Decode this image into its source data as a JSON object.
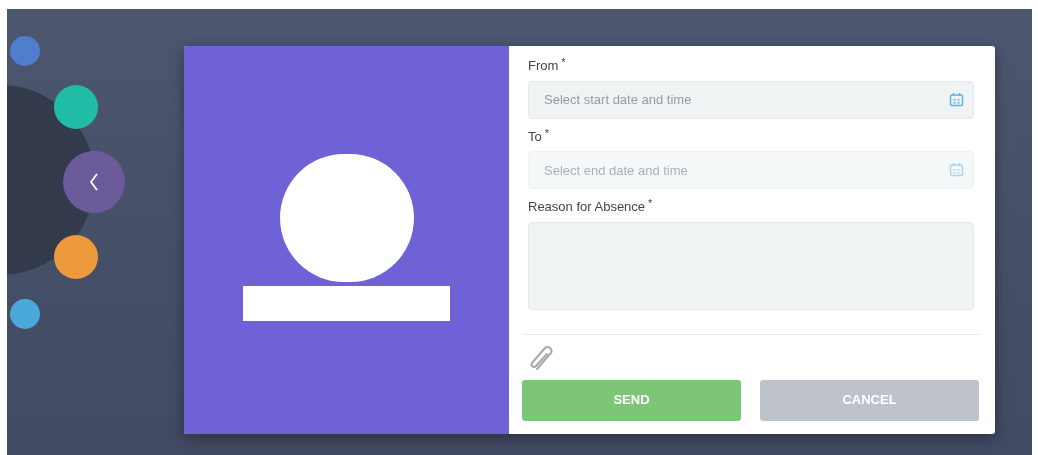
{
  "side_menu": {
    "dots": [
      {
        "color": "#4f7fcc"
      },
      {
        "color": "#1fbda6"
      },
      {
        "color": "#ec9a3c"
      },
      {
        "color": "#4aa9d9"
      }
    ]
  },
  "profile_panel": {
    "kind": "placeholder"
  },
  "form": {
    "fields": [
      {
        "kind": "date",
        "label": "From",
        "required_mark": "*",
        "placeholder": "Select start date and time",
        "disabled": false
      },
      {
        "kind": "date",
        "label": "To",
        "required_mark": "*",
        "placeholder": "Select end date and time",
        "disabled": true
      },
      {
        "kind": "textarea",
        "label": "Reason for Absence",
        "required_mark": "*"
      }
    ],
    "buttons": [
      {
        "kind": "primary",
        "label": "SEND"
      },
      {
        "kind": "secondary",
        "label": "CANCEL"
      }
    ]
  }
}
